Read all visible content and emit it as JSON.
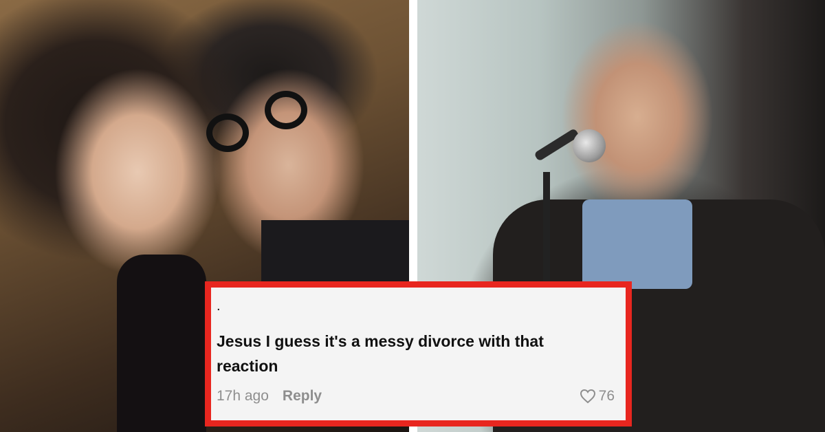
{
  "comment": {
    "dot": ".",
    "text": "Jesus I guess it's a messy divorce with that reaction",
    "timestamp": "17h ago",
    "reply_label": "Reply",
    "like_count": "76",
    "like_icon": "heart-outline-icon"
  },
  "colors": {
    "card_border": "#e8261f",
    "card_background": "#f4f4f4",
    "meta_text": "#8e8e8e"
  }
}
